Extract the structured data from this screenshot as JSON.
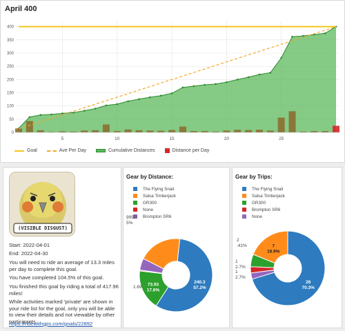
{
  "page": {
    "title": "April 400"
  },
  "chart_data": {
    "type": "line",
    "x": [
      1,
      2,
      3,
      4,
      5,
      6,
      7,
      8,
      9,
      10,
      11,
      12,
      13,
      14,
      15,
      16,
      17,
      18,
      19,
      20,
      21,
      22,
      23,
      24,
      25,
      26,
      27,
      28,
      29,
      30
    ],
    "xticks": [
      5,
      10,
      15,
      20,
      25
    ],
    "ylim": [
      0,
      420
    ],
    "yticks": [
      0,
      50,
      100,
      150,
      200,
      250,
      300,
      350,
      400
    ],
    "grid": true,
    "legend_position": "bottom",
    "series": [
      {
        "name": "Goal",
        "type": "line",
        "color": "#f5c518",
        "values": [
          400,
          400,
          400,
          400,
          400,
          400,
          400,
          400,
          400,
          400,
          400,
          400,
          400,
          400,
          400,
          400,
          400,
          400,
          400,
          400,
          400,
          400,
          400,
          400,
          400,
          400,
          400,
          400,
          400,
          400
        ]
      },
      {
        "name": "Ave Per Day",
        "type": "dashed-line",
        "color": "#f5a623",
        "values": [
          13.3,
          26.7,
          40,
          53.3,
          66.7,
          80,
          93.3,
          106.7,
          120,
          133.3,
          146.7,
          160,
          173.3,
          186.7,
          200,
          213.3,
          226.7,
          240,
          253.3,
          266.7,
          280,
          293.3,
          306.7,
          320,
          333.3,
          346.7,
          360,
          373.3,
          386.7,
          400
        ]
      },
      {
        "name": "Cumulative Distances",
        "type": "area",
        "color": "#5cb85c",
        "values": [
          15,
          58,
          66,
          68,
          72,
          75,
          82,
          90,
          102,
          107,
          118,
          126,
          133,
          139,
          148,
          170,
          175,
          180,
          183,
          190,
          200,
          209,
          219,
          226,
          282,
          362,
          365,
          370,
          375,
          400
        ]
      },
      {
        "name": "Distance per Day",
        "type": "bar",
        "color": "#8b6f30",
        "values": [
          15,
          43,
          8,
          2,
          4,
          3,
          7,
          8,
          30,
          5,
          11,
          8,
          7,
          6,
          9,
          22,
          5,
          5,
          3,
          7,
          10,
          9,
          10,
          7,
          56,
          80,
          3,
          5,
          5,
          25
        ]
      }
    ]
  },
  "info": {
    "badge_caption": "(VISIBLE DISGUST)",
    "start": "Start: 2022-04-01",
    "end": "End: 2022-04-30",
    "average": "You will need to ride an average of 13.3 miles per day to complete this goal.",
    "completed": "You have completed 104.5% of this goal.",
    "finished": "You finished this goal by riding a total of 417.96 miles!",
    "private_note": "While activities marked 'private' are shown in your ride list for the goal, only you will be able to view their details and not viewable by other participants.",
    "link": "https://ridewithgps.com/goals/22892"
  },
  "gear_distance": {
    "title": "Gear by Distance:",
    "legend": [
      {
        "label": "The Flying Snail",
        "color": "#2e7bbf"
      },
      {
        "label": "Salsa Timberjack",
        "color": "#ff8c1a"
      },
      {
        "label": "GR300",
        "color": "#2ca02c"
      },
      {
        "label": "None",
        "color": "#d62728"
      },
      {
        "label": "Brompton SR6",
        "color": "#9467bd"
      }
    ],
    "slices": [
      {
        "label": "240.3",
        "pct": "57.2%",
        "value": 240.3,
        "color": "#2e7bbf"
      },
      {
        "label": "73.93",
        "pct": "17.6%",
        "value": 73.93,
        "color": "#2ca02c"
      },
      {
        "label": "1.69",
        "pct": "",
        "value": 1.69,
        "color": "#d62728"
      },
      {
        "label": "999P",
        "pct": "5%",
        "value": 22,
        "color": "#9467bd"
      },
      {
        "label": "",
        "pct": "",
        "value": 80.04,
        "color": "#ff8c1a"
      }
    ]
  },
  "gear_trips": {
    "title": "Gear by Trips:",
    "legend": [
      {
        "label": "The Flying Snail",
        "color": "#2e7bbf"
      },
      {
        "label": "Salsa Timberjack",
        "color": "#ff8c1a"
      },
      {
        "label": "GR300",
        "color": "#2ca02c"
      },
      {
        "label": "Brompton SR6",
        "color": "#d62728"
      },
      {
        "label": "None",
        "color": "#9467bd"
      }
    ],
    "slices": [
      {
        "label": "26",
        "pct": "70.3%",
        "value": 26,
        "color": "#2e7bbf"
      },
      {
        "label": "1",
        "pct": "2.7%",
        "value": 1,
        "color": "#9467bd"
      },
      {
        "label": "1",
        "pct": "2.7%",
        "value": 1,
        "color": "#d62728"
      },
      {
        "label": "2",
        "pct": ".41%",
        "value": 2,
        "color": "#2ca02c"
      },
      {
        "label": "7",
        "pct": "18.9%",
        "value": 7,
        "color": "#ff8c1a"
      }
    ]
  }
}
